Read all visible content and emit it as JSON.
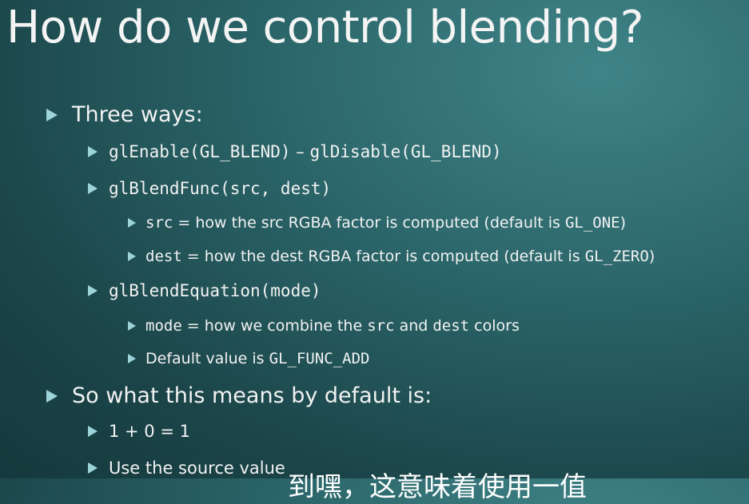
{
  "title": "How do we control blending?",
  "b1": "Three ways:",
  "b1_1_a": "glEnable(GL_BLEND)",
  "b1_1_sep": " – ",
  "b1_1_b": "glDisable(GL_BLEND)",
  "b1_2": "glBlendFunc(src, dest)",
  "b1_2_1_code": "src",
  "b1_2_1_text": " = how the src RGBA factor is computed (default is ",
  "b1_2_1_def": "GL_ONE",
  "b1_2_1_end": ")",
  "b1_2_2_code": "dest",
  "b1_2_2_text": " = how the dest RGBA factor is computed (default is ",
  "b1_2_2_def": "GL_ZERO",
  "b1_2_2_end": ")",
  "b1_3": "glBlendEquation(mode)",
  "b1_3_1_code": "mode",
  "b1_3_1_t1": " = how we combine the ",
  "b1_3_1_src": "src",
  "b1_3_1_t2": " and ",
  "b1_3_1_dest": "dest",
  "b1_3_1_t3": " colors",
  "b1_3_2_text": "Default value is ",
  "b1_3_2_code": "GL_FUNC_ADD",
  "b2": "So what this means by default is:",
  "b2_1": "1 + 0 = 1",
  "b2_2": "Use the source value",
  "subtitle": "到嘿，这意味着使用一值"
}
